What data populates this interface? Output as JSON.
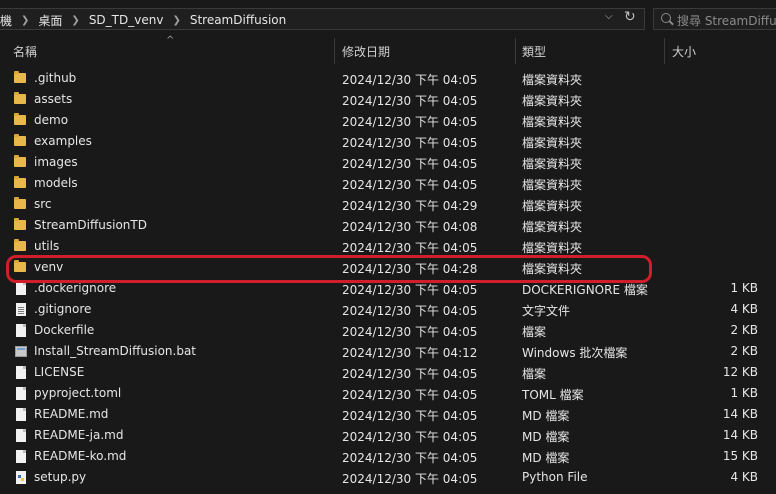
{
  "address": {
    "crumbs": [
      "機",
      "桌面",
      "SD_TD_venv",
      "StreamDiffusion"
    ],
    "search_placeholder": "搜尋 StreamDiffusion"
  },
  "columns": {
    "name": "名稱",
    "date": "修改日期",
    "type": "類型",
    "size": "大小"
  },
  "files": [
    {
      "name": ".github",
      "date": "2024/12/30 下午 04:05",
      "type": "檔案資料夾",
      "size": "",
      "icon": "folder-icon"
    },
    {
      "name": "assets",
      "date": "2024/12/30 下午 04:05",
      "type": "檔案資料夾",
      "size": "",
      "icon": "folder-icon"
    },
    {
      "name": "demo",
      "date": "2024/12/30 下午 04:05",
      "type": "檔案資料夾",
      "size": "",
      "icon": "folder-icon"
    },
    {
      "name": "examples",
      "date": "2024/12/30 下午 04:05",
      "type": "檔案資料夾",
      "size": "",
      "icon": "folder-icon"
    },
    {
      "name": "images",
      "date": "2024/12/30 下午 04:05",
      "type": "檔案資料夾",
      "size": "",
      "icon": "folder-icon"
    },
    {
      "name": "models",
      "date": "2024/12/30 下午 04:05",
      "type": "檔案資料夾",
      "size": "",
      "icon": "folder-icon"
    },
    {
      "name": "src",
      "date": "2024/12/30 下午 04:29",
      "type": "檔案資料夾",
      "size": "",
      "icon": "folder-icon"
    },
    {
      "name": "StreamDiffusionTD",
      "date": "2024/12/30 下午 04:08",
      "type": "檔案資料夾",
      "size": "",
      "icon": "folder-icon"
    },
    {
      "name": "utils",
      "date": "2024/12/30 下午 04:05",
      "type": "檔案資料夾",
      "size": "",
      "icon": "folder-icon"
    },
    {
      "name": "venv",
      "date": "2024/12/30 下午 04:28",
      "type": "檔案資料夾",
      "size": "",
      "icon": "folder-icon"
    },
    {
      "name": ".dockerignore",
      "date": "2024/12/30 下午 04:05",
      "type": "DOCKERIGNORE 檔案",
      "size": "1 KB",
      "icon": "file-icon"
    },
    {
      "name": ".gitignore",
      "date": "2024/12/30 下午 04:05",
      "type": "文字文件",
      "size": "4 KB",
      "icon": "text-icon"
    },
    {
      "name": "Dockerfile",
      "date": "2024/12/30 下午 04:05",
      "type": "檔案",
      "size": "2 KB",
      "icon": "file-icon"
    },
    {
      "name": "Install_StreamDiffusion.bat",
      "date": "2024/12/30 下午 04:12",
      "type": "Windows 批次檔案",
      "size": "2 KB",
      "icon": "bat-icon"
    },
    {
      "name": "LICENSE",
      "date": "2024/12/30 下午 04:05",
      "type": "檔案",
      "size": "12 KB",
      "icon": "file-icon"
    },
    {
      "name": "pyproject.toml",
      "date": "2024/12/30 下午 04:05",
      "type": "TOML 檔案",
      "size": "1 KB",
      "icon": "file-icon"
    },
    {
      "name": "README.md",
      "date": "2024/12/30 下午 04:05",
      "type": "MD 檔案",
      "size": "14 KB",
      "icon": "file-icon"
    },
    {
      "name": "README-ja.md",
      "date": "2024/12/30 下午 04:05",
      "type": "MD 檔案",
      "size": "14 KB",
      "icon": "file-icon"
    },
    {
      "name": "README-ko.md",
      "date": "2024/12/30 下午 04:05",
      "type": "MD 檔案",
      "size": "15 KB",
      "icon": "file-icon"
    },
    {
      "name": "setup.py",
      "date": "2024/12/30 下午 04:05",
      "type": "Python File",
      "size": "4 KB",
      "icon": "py-icon"
    }
  ],
  "highlight": {
    "color": "#d01f2a"
  }
}
